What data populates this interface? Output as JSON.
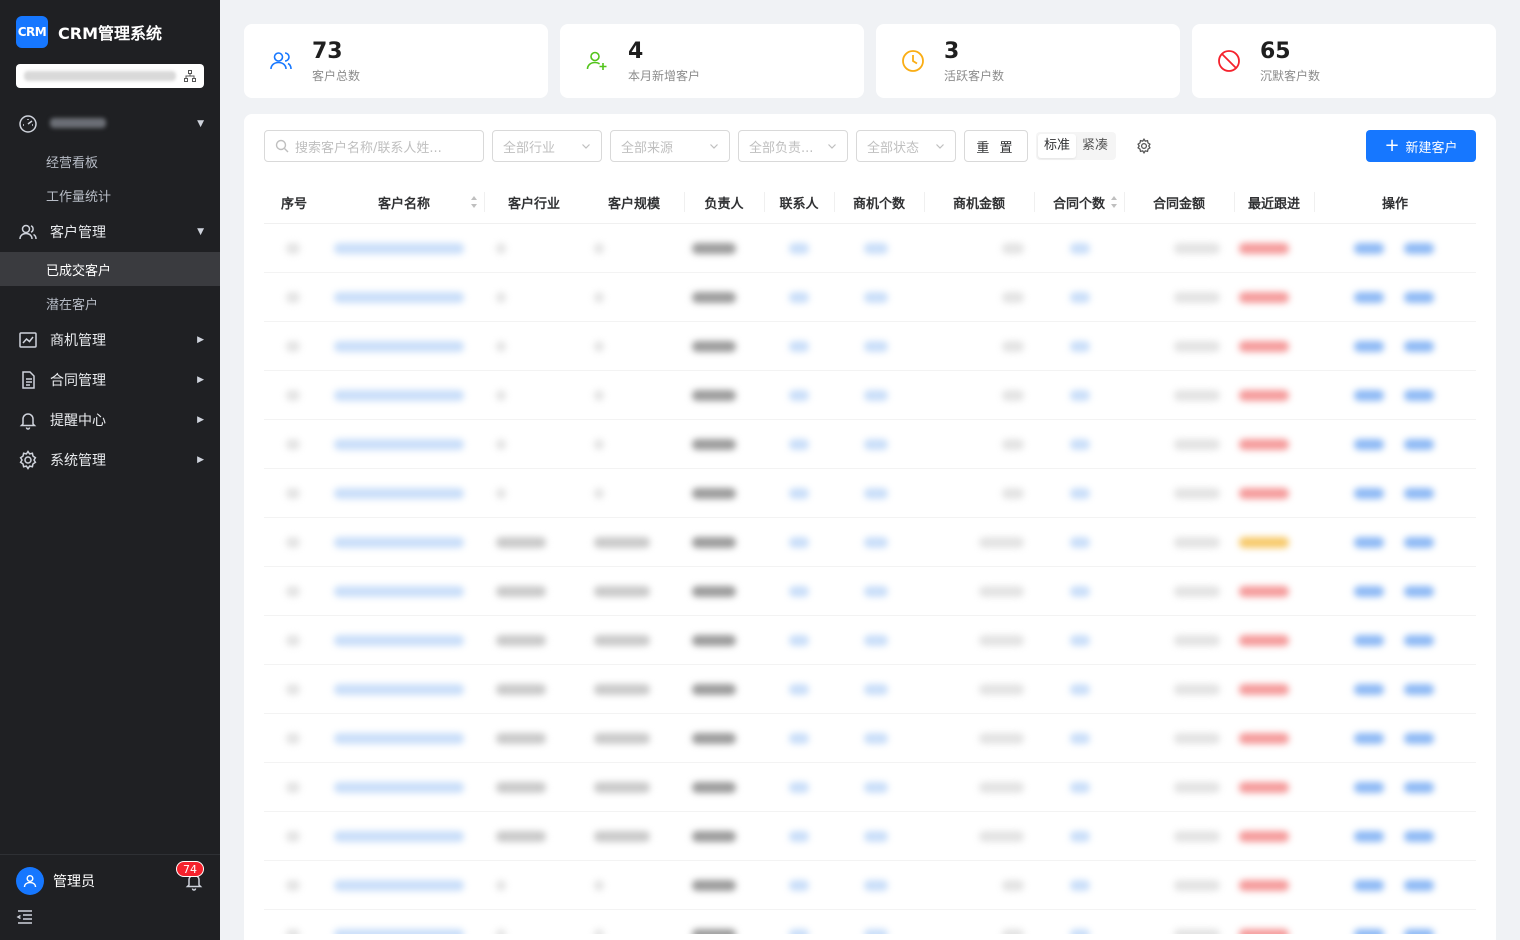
{
  "app": {
    "logo_text": "CRM",
    "title": "CRM管理系统"
  },
  "sidebar": {
    "dashboard_group_label": "",
    "dashboard_items": [
      {
        "label": "经营看板"
      },
      {
        "label": "工作量统计"
      }
    ],
    "customer_group": {
      "label": "客户管理",
      "items": [
        {
          "label": "已成交客户",
          "active": true
        },
        {
          "label": "潜在客户"
        }
      ]
    },
    "groups": [
      {
        "label": "商机管理"
      },
      {
        "label": "合同管理"
      },
      {
        "label": "提醒中心"
      },
      {
        "label": "系统管理"
      }
    ],
    "user": {
      "name": "管理员",
      "notification_count": "74"
    }
  },
  "stats": [
    {
      "value": "73",
      "label": "客户总数",
      "icon": "users-icon",
      "color": "#1677ff"
    },
    {
      "value": "4",
      "label": "本月新增客户",
      "icon": "user-add-icon",
      "color": "#52c41a"
    },
    {
      "value": "3",
      "label": "活跃客户数",
      "icon": "clock-icon",
      "color": "#faad14"
    },
    {
      "value": "65",
      "label": "沉默客户数",
      "icon": "stop-icon",
      "color": "#f5222d"
    }
  ],
  "filters": {
    "search_placeholder": "搜索客户名称/联系人姓...",
    "industry": "全部行业",
    "source": "全部来源",
    "owner": "全部负责...",
    "status": "全部状态",
    "reset_label": "重 置",
    "density_standard": "标准",
    "density_compact": "紧凑",
    "new_button": "新建客户"
  },
  "table": {
    "columns": [
      "序号",
      "客户名称",
      "客户行业",
      "客户规模",
      "负责人",
      "联系人",
      "商机个数",
      "商机金额",
      "合同个数",
      "合同金额",
      "最近跟进",
      "操作"
    ]
  },
  "colors": {
    "primary": "#1677ff",
    "sidebar_bg": "#1f2023",
    "danger": "#f5222d"
  }
}
